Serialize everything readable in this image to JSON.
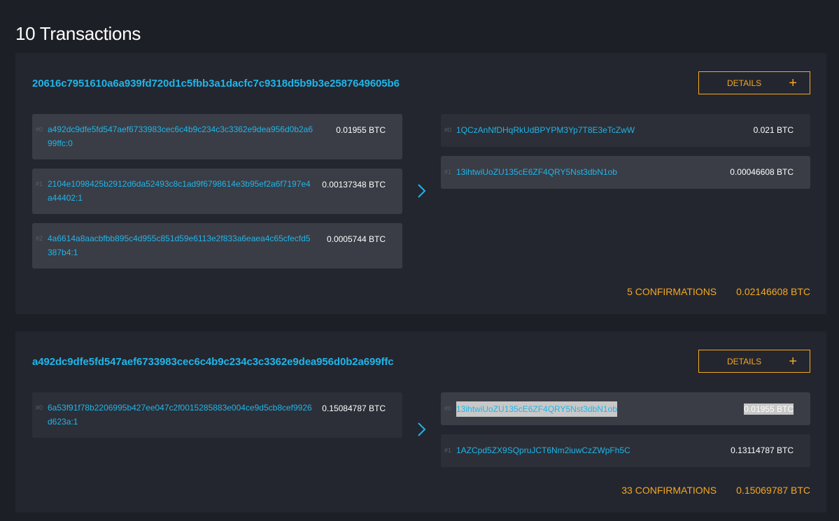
{
  "page": {
    "title": "10 Transactions"
  },
  "transactions": [
    {
      "hash": "20616c7951610a6a939fd720d1c5fbb3a1dacfc7c9318d5b9b3e2587649605b6",
      "details_label": "DETAILS",
      "details_icon": "+",
      "inputs": [
        {
          "index": "#0",
          "address": "a492dc9dfe5fd547aef6733983cec6c4b9c234c3c3362e9dea956d0b2a699ffc:0",
          "amount": "0.01955 BTC"
        },
        {
          "index": "#1",
          "address": "2104e1098425b2912d6da52493c8c1ad9f6798614e3b95ef2a6f7197e4a44402:1",
          "amount": "0.00137348 BTC"
        },
        {
          "index": "#2",
          "address": "4a6614a8aacbfbb895c4d955c851d59e6113e2f833a6eaea4c65cfecfd5387b4:1",
          "amount": "0.0005744 BTC"
        }
      ],
      "outputs": [
        {
          "index": "#0",
          "address": "1QCzAnNfDHqRkUdBPYPM3Yp7T8E3eTcZwW",
          "amount": "0.021 BTC"
        },
        {
          "index": "#1",
          "address": "13ihtwiUoZU135cE6ZF4QRY5Nst3dbN1ob",
          "amount": "0.00046608 BTC"
        }
      ],
      "confirmations": "5 CONFIRMATIONS",
      "total": "0.02146608 BTC"
    },
    {
      "hash": "a492dc9dfe5fd547aef6733983cec6c4b9c234c3c3362e9dea956d0b2a699ffc",
      "details_label": "DETAILS",
      "details_icon": "+",
      "inputs": [
        {
          "index": "#0",
          "address": "6a53f91f78b2206995b427ee047c2f0015285883e004ce9d5cb8cef9926d623a:1",
          "amount": "0.15084787 BTC"
        }
      ],
      "outputs": [
        {
          "index": "#0",
          "address": "13ihtwiUoZU135cE6ZF4QRY5Nst3dbN1ob",
          "amount": "0.01955 BTC"
        },
        {
          "index": "#1",
          "address": "1AZCpd5ZX9SQpruJCT6Nm2iuwCzZWpFh5C",
          "amount": "0.13114787 BTC"
        }
      ],
      "confirmations": "33 CONFIRMATIONS",
      "total": "0.15069787 BTC"
    }
  ],
  "icons": {
    "arrow": "chevron-right-icon",
    "details": "plus-icon"
  },
  "colors": {
    "accent_blue": "#20b5e8",
    "accent_orange": "#f6a821",
    "background": "#1d1f27",
    "card": "#23262f"
  }
}
